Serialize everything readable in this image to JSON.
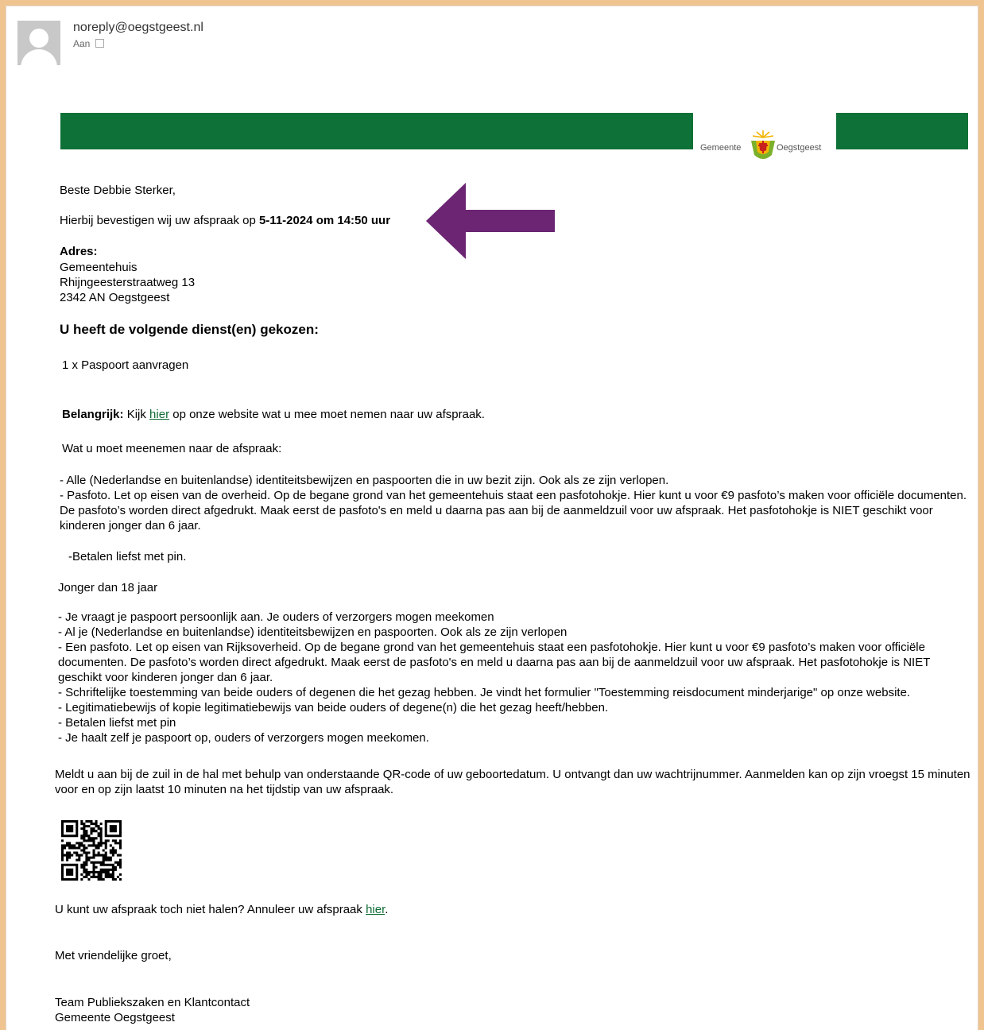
{
  "email": {
    "from": "noreply@oegstgeest.nl",
    "to_label": "Aan"
  },
  "logo": {
    "word1": "Gemeente",
    "word2": "Oegstgeest"
  },
  "body": {
    "greeting": "Beste Debbie Sterker,",
    "confirm_prefix": "Hierbij bevestigen wij uw afspraak op ",
    "confirm_datetime": "5-11-2024 om 14:50 uur",
    "address_label": "Adres:",
    "address_lines": [
      "Gemeentehuis",
      "Rhijngeesterstraatweg 13",
      "2342 AN Oegstgeest"
    ],
    "services_heading": "U heeft de volgende dienst(en) gekozen:",
    "service_item": "1 x Paspoort aanvragen",
    "important_label": "Belangrijk:",
    "important_pre": " Kijk ",
    "important_link": "hier",
    "important_post": " op onze website wat u mee moet nemen naar uw afspraak.",
    "bring_heading": "Wat u moet meenemen naar de afspraak:",
    "bring_items": [
      "- Alle (Nederlandse en buitenlandse) identiteitsbewijzen en paspoorten die in uw bezit zijn. Ook als ze zijn verlopen.",
      "- Pasfoto. Let op eisen van de overheid. Op de begane grond van het gemeentehuis staat een pasfotohokje. Hier kunt u voor €9 pasfoto’s maken voor officiële documenten. De pasfoto’s worden direct afgedrukt. Maak eerst de  pasfoto's en meld u daarna pas aan bij de aanmeldzuil voor uw afspraak. Het pasfotohokje is NIET geschikt voor kinderen jonger dan 6 jaar."
    ],
    "pay_note": "-Betalen liefst met pin.",
    "minor_heading": "Jonger dan 18 jaar",
    "minor_items": [
      "- Je vraagt je paspoort persoonlijk aan. Je ouders of verzorgers mogen meekomen",
      "- Al je (Nederlandse en buitenlandse) identiteitsbewijzen en paspoorten. Ook als ze zijn verlopen",
      "- Een pasfoto. Let op eisen van Rijksoverheid. Op de begane grond van het gemeentehuis staat een pasfotohokje. Hier kunt u voor €9 pasfoto’s maken voor officiële documenten. De pasfoto’s worden direct afgedrukt. Maak eerst de pasfoto's en meld u daarna pas aan bij de aanmeldzuil voor uw afspraak. Het pasfotohokje is NIET geschikt voor kinderen jonger dan 6 jaar.",
      "- Schriftelijke toestemming van beide ouders of degenen die het gezag hebben. Je vindt het formulier \"Toestemming reisdocument minderjarige\" op onze website.",
      "- Legitimatiebewijs of kopie legitimatiebewijs van beide ouders of degene(n) die het gezag heeft/hebben.",
      "- Betalen liefst met pin",
      "- Je haalt zelf je paspoort op, ouders of verzorgers mogen meekomen."
    ],
    "checkin_text": "Meldt u aan bij de zuil in de hal met behulp van onderstaande QR-code of uw geboortedatum. U ontvangt dan uw wachtrijnummer. Aanmelden kan op zijn vroegst 15 minuten voor en op zijn laatst 10 minuten na het tijdstip van uw afspraak.",
    "cancel_pre": "U kunt uw afspraak toch niet halen? Annuleer uw afspraak ",
    "cancel_link": "hier",
    "cancel_post": ".",
    "closing": "Met vriendelijke groet,",
    "signature": [
      "Team Publiekszaken en Klantcontact",
      "Gemeente Oegstgeest"
    ]
  },
  "colors": {
    "banner_green": "#0e7137",
    "arrow_purple": "#6b2572",
    "link_green": "#0e6b33",
    "page_border": "#f0c490"
  }
}
